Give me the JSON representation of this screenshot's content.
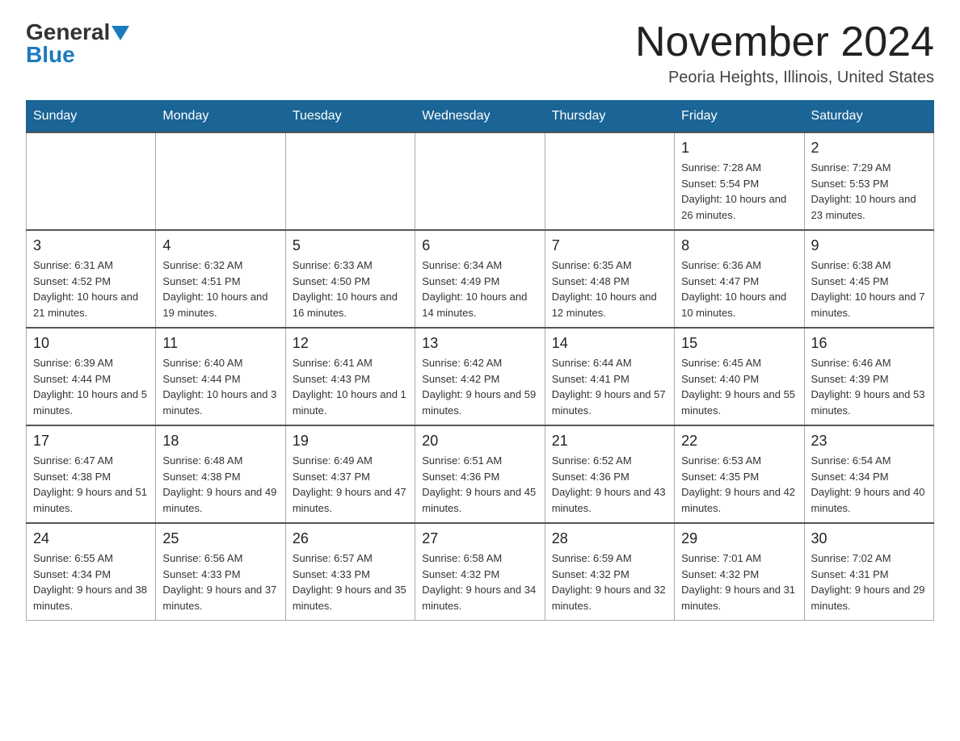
{
  "logo": {
    "general": "General",
    "blue": "Blue",
    "arrow": "▼"
  },
  "title": "November 2024",
  "location": "Peoria Heights, Illinois, United States",
  "days_of_week": [
    "Sunday",
    "Monday",
    "Tuesday",
    "Wednesday",
    "Thursday",
    "Friday",
    "Saturday"
  ],
  "weeks": [
    [
      {
        "day": "",
        "info": ""
      },
      {
        "day": "",
        "info": ""
      },
      {
        "day": "",
        "info": ""
      },
      {
        "day": "",
        "info": ""
      },
      {
        "day": "",
        "info": ""
      },
      {
        "day": "1",
        "info": "Sunrise: 7:28 AM\nSunset: 5:54 PM\nDaylight: 10 hours and 26 minutes."
      },
      {
        "day": "2",
        "info": "Sunrise: 7:29 AM\nSunset: 5:53 PM\nDaylight: 10 hours and 23 minutes."
      }
    ],
    [
      {
        "day": "3",
        "info": "Sunrise: 6:31 AM\nSunset: 4:52 PM\nDaylight: 10 hours and 21 minutes."
      },
      {
        "day": "4",
        "info": "Sunrise: 6:32 AM\nSunset: 4:51 PM\nDaylight: 10 hours and 19 minutes."
      },
      {
        "day": "5",
        "info": "Sunrise: 6:33 AM\nSunset: 4:50 PM\nDaylight: 10 hours and 16 minutes."
      },
      {
        "day": "6",
        "info": "Sunrise: 6:34 AM\nSunset: 4:49 PM\nDaylight: 10 hours and 14 minutes."
      },
      {
        "day": "7",
        "info": "Sunrise: 6:35 AM\nSunset: 4:48 PM\nDaylight: 10 hours and 12 minutes."
      },
      {
        "day": "8",
        "info": "Sunrise: 6:36 AM\nSunset: 4:47 PM\nDaylight: 10 hours and 10 minutes."
      },
      {
        "day": "9",
        "info": "Sunrise: 6:38 AM\nSunset: 4:45 PM\nDaylight: 10 hours and 7 minutes."
      }
    ],
    [
      {
        "day": "10",
        "info": "Sunrise: 6:39 AM\nSunset: 4:44 PM\nDaylight: 10 hours and 5 minutes."
      },
      {
        "day": "11",
        "info": "Sunrise: 6:40 AM\nSunset: 4:44 PM\nDaylight: 10 hours and 3 minutes."
      },
      {
        "day": "12",
        "info": "Sunrise: 6:41 AM\nSunset: 4:43 PM\nDaylight: 10 hours and 1 minute."
      },
      {
        "day": "13",
        "info": "Sunrise: 6:42 AM\nSunset: 4:42 PM\nDaylight: 9 hours and 59 minutes."
      },
      {
        "day": "14",
        "info": "Sunrise: 6:44 AM\nSunset: 4:41 PM\nDaylight: 9 hours and 57 minutes."
      },
      {
        "day": "15",
        "info": "Sunrise: 6:45 AM\nSunset: 4:40 PM\nDaylight: 9 hours and 55 minutes."
      },
      {
        "day": "16",
        "info": "Sunrise: 6:46 AM\nSunset: 4:39 PM\nDaylight: 9 hours and 53 minutes."
      }
    ],
    [
      {
        "day": "17",
        "info": "Sunrise: 6:47 AM\nSunset: 4:38 PM\nDaylight: 9 hours and 51 minutes."
      },
      {
        "day": "18",
        "info": "Sunrise: 6:48 AM\nSunset: 4:38 PM\nDaylight: 9 hours and 49 minutes."
      },
      {
        "day": "19",
        "info": "Sunrise: 6:49 AM\nSunset: 4:37 PM\nDaylight: 9 hours and 47 minutes."
      },
      {
        "day": "20",
        "info": "Sunrise: 6:51 AM\nSunset: 4:36 PM\nDaylight: 9 hours and 45 minutes."
      },
      {
        "day": "21",
        "info": "Sunrise: 6:52 AM\nSunset: 4:36 PM\nDaylight: 9 hours and 43 minutes."
      },
      {
        "day": "22",
        "info": "Sunrise: 6:53 AM\nSunset: 4:35 PM\nDaylight: 9 hours and 42 minutes."
      },
      {
        "day": "23",
        "info": "Sunrise: 6:54 AM\nSunset: 4:34 PM\nDaylight: 9 hours and 40 minutes."
      }
    ],
    [
      {
        "day": "24",
        "info": "Sunrise: 6:55 AM\nSunset: 4:34 PM\nDaylight: 9 hours and 38 minutes."
      },
      {
        "day": "25",
        "info": "Sunrise: 6:56 AM\nSunset: 4:33 PM\nDaylight: 9 hours and 37 minutes."
      },
      {
        "day": "26",
        "info": "Sunrise: 6:57 AM\nSunset: 4:33 PM\nDaylight: 9 hours and 35 minutes."
      },
      {
        "day": "27",
        "info": "Sunrise: 6:58 AM\nSunset: 4:32 PM\nDaylight: 9 hours and 34 minutes."
      },
      {
        "day": "28",
        "info": "Sunrise: 6:59 AM\nSunset: 4:32 PM\nDaylight: 9 hours and 32 minutes."
      },
      {
        "day": "29",
        "info": "Sunrise: 7:01 AM\nSunset: 4:32 PM\nDaylight: 9 hours and 31 minutes."
      },
      {
        "day": "30",
        "info": "Sunrise: 7:02 AM\nSunset: 4:31 PM\nDaylight: 9 hours and 29 minutes."
      }
    ]
  ]
}
